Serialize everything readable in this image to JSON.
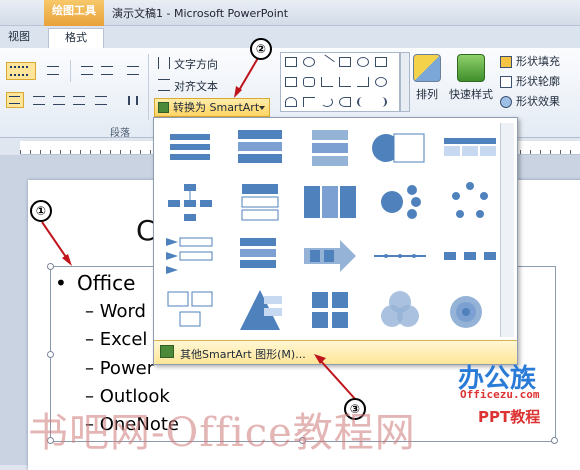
{
  "titlebar": {
    "context_tab": "绘图工具",
    "title": "演示文稿1 - Microsoft PowerPoint"
  },
  "tabs": {
    "view": "视图",
    "format": "格式"
  },
  "ribbon": {
    "text_direction": "文字方向",
    "align_text": "对齐文本",
    "convert_smartart": "转换为 SmartArt",
    "group_paragraph": "段落",
    "arrange": "排列",
    "quick_styles": "快速样式",
    "shape_fill": "形状填充",
    "shape_outline": "形状轮廓",
    "shape_effects": "形状效果"
  },
  "dropdown": {
    "more_smartart": "其他SmartArt 图形(M)..."
  },
  "slide": {
    "title_fragment": "C",
    "bullets": [
      "Office"
    ],
    "sub_bullets": [
      "– Word",
      "– Excel",
      "– Power",
      "– Outlook",
      "– OneNote"
    ]
  },
  "callouts": [
    "①",
    "②",
    "③"
  ],
  "watermark": "书吧网-Office教程网",
  "logo": {
    "cn": "办公族",
    "en": "Officezu.com",
    "ppt": "PPT教程"
  },
  "colors": {
    "accent_highlight": "#ffd463",
    "smartart_blue": "#4f81bd",
    "arrow_red": "#c0141c"
  },
  "icons": [
    "bullets-icon",
    "numbering-icon",
    "indent-icon",
    "text-direction-icon",
    "align-text-icon",
    "smartart-icon",
    "shapes-gallery-icon",
    "arrange-icon",
    "quick-styles-icon",
    "shape-fill-icon",
    "shape-outline-icon",
    "shape-effects-icon"
  ]
}
